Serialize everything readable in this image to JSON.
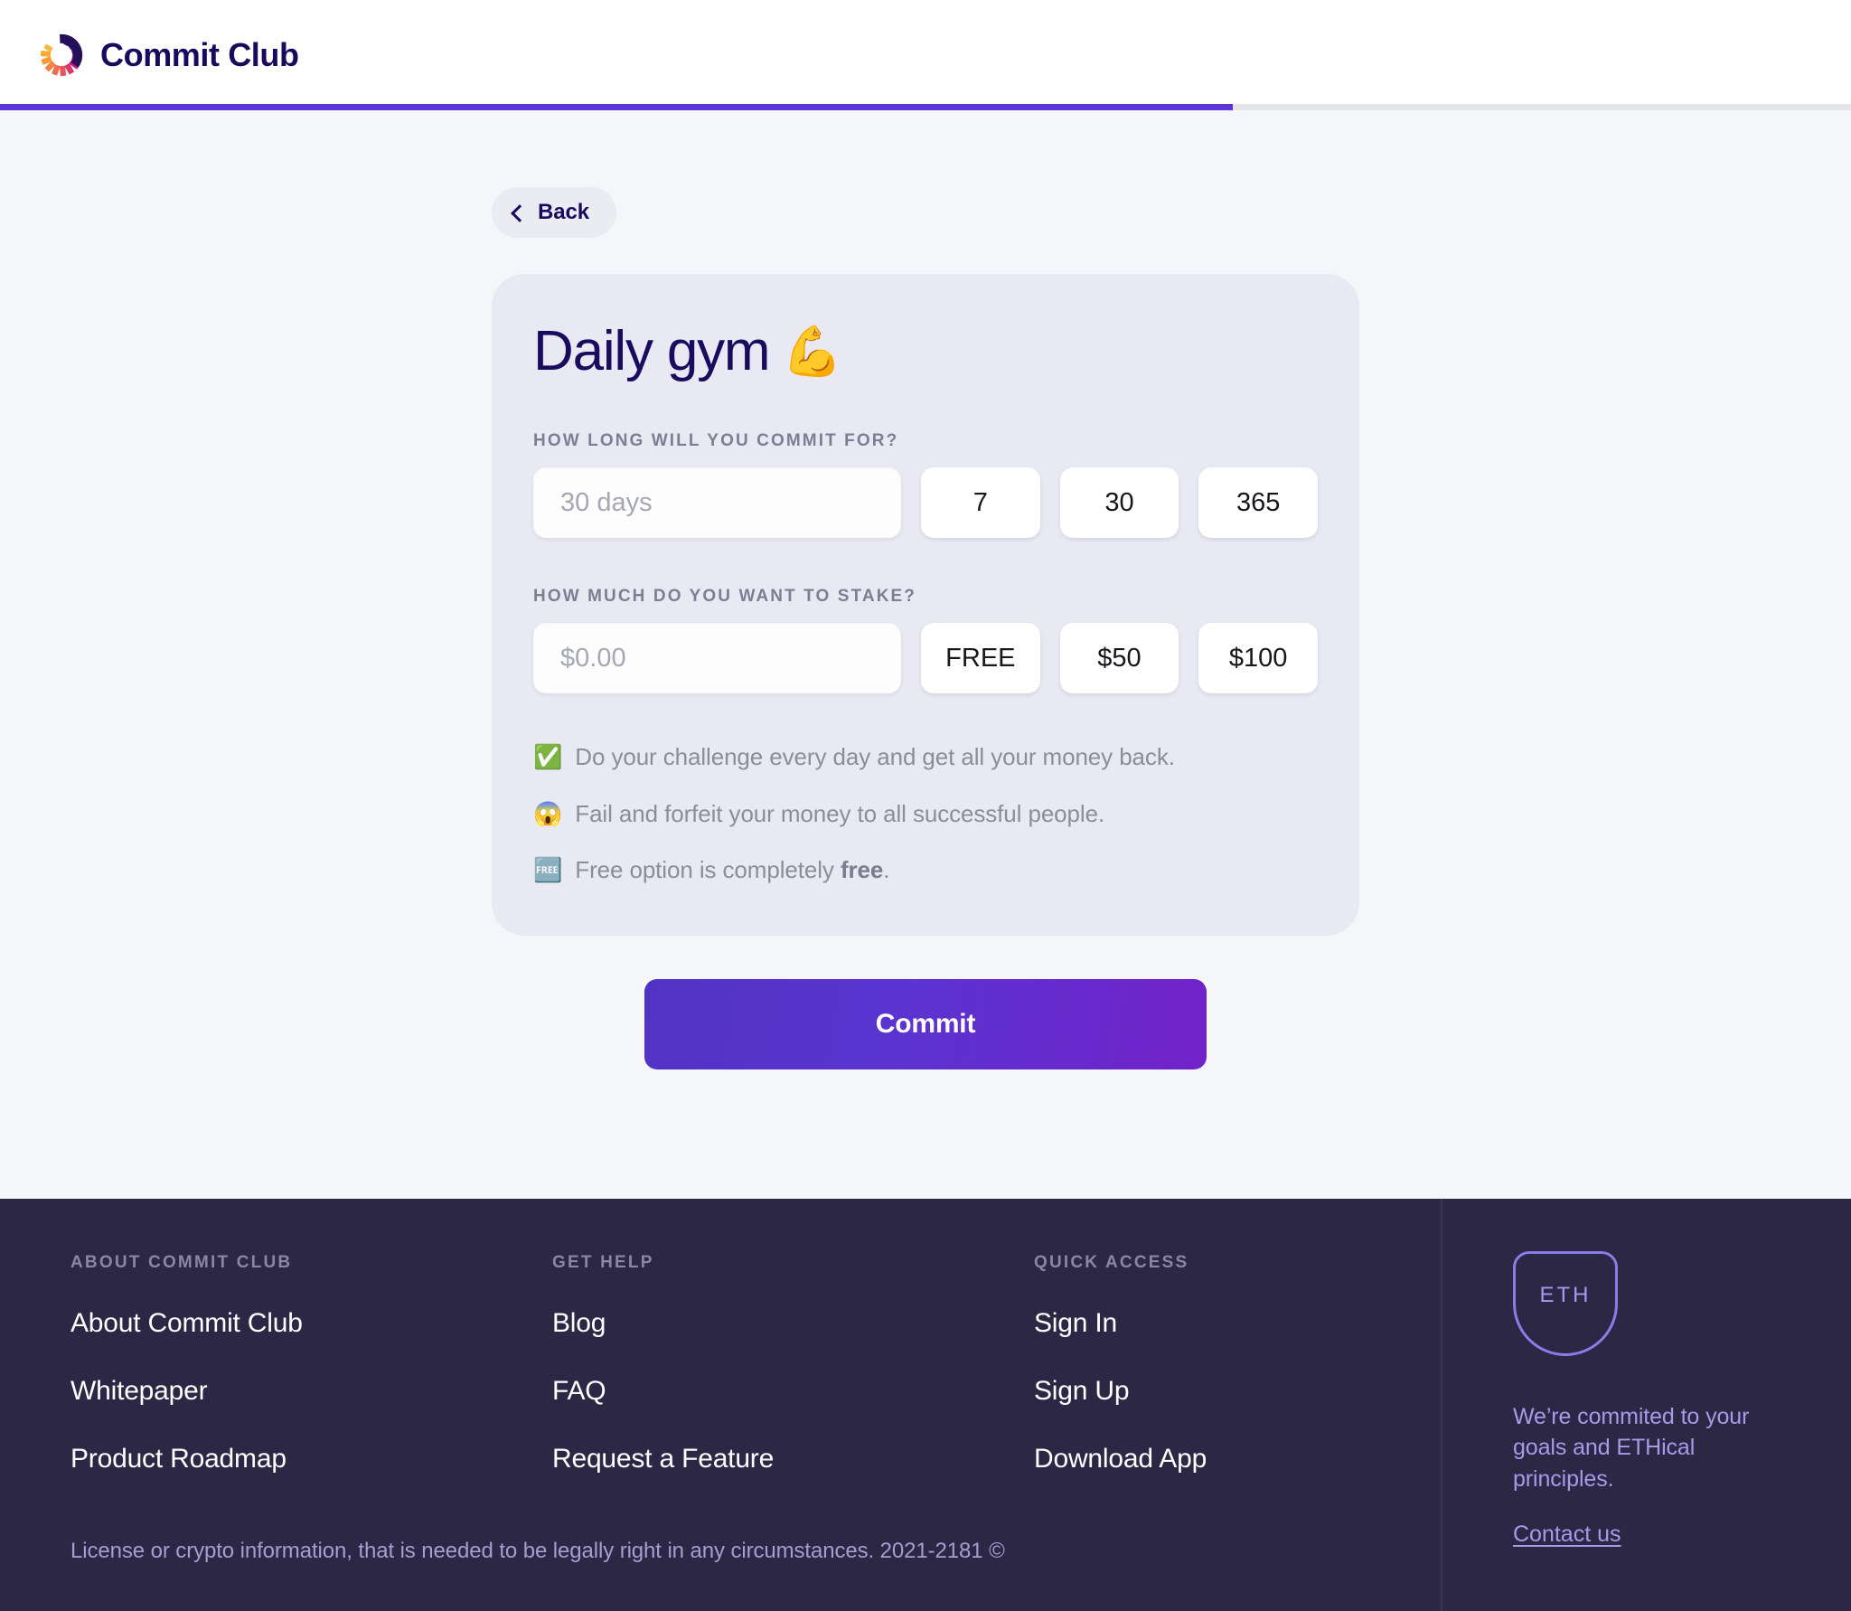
{
  "header": {
    "brand_name": "Commit Club",
    "logo_icon": "commit-club-circular-dashes-logo",
    "progress_percent": 66.6
  },
  "nav": {
    "back_label": "Back",
    "back_icon": "chevron-left-icon"
  },
  "card": {
    "title": "Daily gym",
    "title_emoji": "💪",
    "duration": {
      "label": "How long will you commit for?",
      "input_placeholder": "30 days",
      "input_value": "",
      "options": [
        "7",
        "30",
        "365"
      ]
    },
    "stake": {
      "label": "How much do you want to stake?",
      "input_placeholder": "$0.00",
      "input_value": "",
      "options": [
        "FREE",
        "$50",
        "$100"
      ]
    },
    "notes": [
      {
        "emoji": "✅",
        "icon": "check-mark-button-emoji",
        "text": "Do your challenge every day and get all your money back.",
        "bold": ""
      },
      {
        "emoji": "😱",
        "icon": "screaming-face-emoji",
        "text": "Fail and forfeit your money to all successful people.",
        "bold": ""
      },
      {
        "emoji": "🆓",
        "icon": "free-button-emoji",
        "text": "Free option is completely ",
        "bold": "free",
        "suffix": "."
      }
    ]
  },
  "commit": {
    "label": "Commit"
  },
  "footer": {
    "columns": [
      {
        "heading": "About Commit Club",
        "links": [
          "About Commit Club",
          "Whitepaper",
          "Product Roadmap"
        ]
      },
      {
        "heading": "Get Help",
        "links": [
          "Blog",
          "FAQ",
          "Request a Feature"
        ]
      },
      {
        "heading": "Quick Access",
        "links": [
          "Sign In",
          "Sign Up",
          "Download App"
        ]
      }
    ],
    "legal": "License or crypto information, that is needed to be legally right in any circumstances. 2021-2181 ©",
    "eth": {
      "badge_label": "ETH",
      "badge_icon": "eth-shield-icon",
      "tagline": "We’re commited to your goals and ETHical principles.",
      "contact_label": "Contact us"
    }
  },
  "colors": {
    "accent": "#5b35d5",
    "brand_navy": "#1a0a5e",
    "footer_bg": "#2b2745",
    "card_bg": "#e8e9f2",
    "page_bg": "#f5f6fa",
    "eth_purple": "#a79ae8"
  }
}
